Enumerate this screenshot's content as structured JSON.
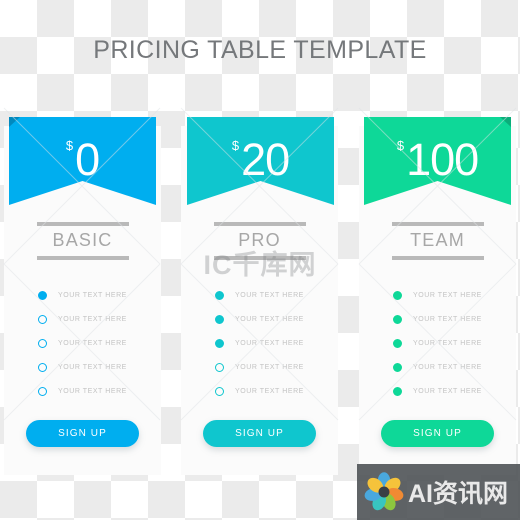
{
  "header": {
    "title": "PRICING TABLE TEMPLATE",
    "title_color": "#75787b"
  },
  "plans": [
    {
      "name": "BASIC",
      "currency": "$",
      "price": "0",
      "color": "#00AEEF",
      "fold_color": "#0089BE",
      "fold_side": "left",
      "cta_label": "SIGN UP",
      "features": [
        {
          "label": "YOUR TEXT HERE",
          "active": true
        },
        {
          "label": "YOUR TEXT HERE",
          "active": false
        },
        {
          "label": "YOUR TEXT HERE",
          "active": false
        },
        {
          "label": "YOUR TEXT HERE",
          "active": false
        },
        {
          "label": "YOUR TEXT HERE",
          "active": false
        }
      ]
    },
    {
      "name": "PRO",
      "currency": "$",
      "price": "20",
      "color": "#0FC6CE",
      "fold_color": "#0C9EA4",
      "fold_side": "none",
      "cta_label": "SIGN UP",
      "features": [
        {
          "label": "YOUR TEXT HERE",
          "active": true
        },
        {
          "label": "YOUR TEXT HERE",
          "active": true
        },
        {
          "label": "YOUR TEXT HERE",
          "active": true
        },
        {
          "label": "YOUR TEXT HERE",
          "active": false
        },
        {
          "label": "YOUR TEXT HERE",
          "active": false
        }
      ]
    },
    {
      "name": "TEAM",
      "currency": "$",
      "price": "100",
      "color": "#0ED898",
      "fold_color": "#0BAD7A",
      "fold_side": "right",
      "cta_label": "SIGN UP",
      "features": [
        {
          "label": "YOUR TEXT HERE",
          "active": true
        },
        {
          "label": "YOUR TEXT HERE",
          "active": true
        },
        {
          "label": "YOUR TEXT HERE",
          "active": true
        },
        {
          "label": "YOUR TEXT HERE",
          "active": true
        },
        {
          "label": "YOUR TEXT HERE",
          "active": true
        }
      ]
    }
  ],
  "watermarks": {
    "center": "IC千库网",
    "badge_text": "AI资讯网",
    "badge_logo_icon": "flower-logo-icon"
  }
}
